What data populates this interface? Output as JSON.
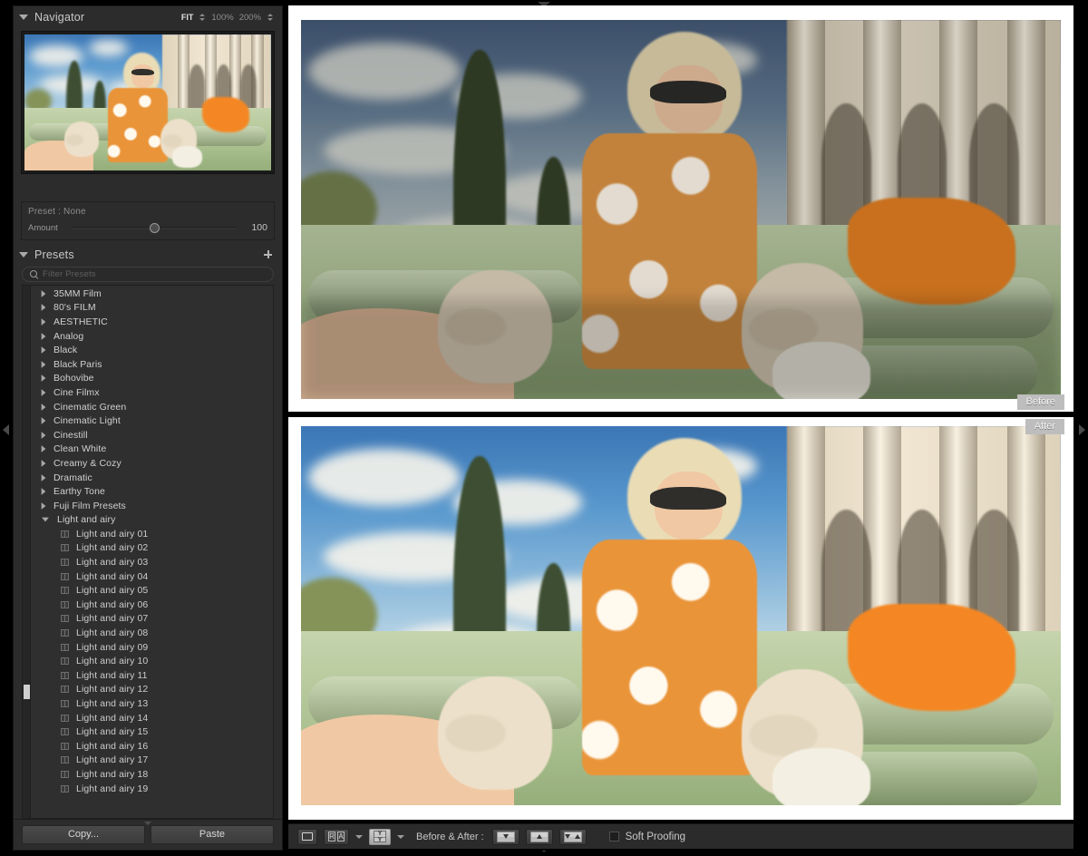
{
  "app": {
    "module": "Develop"
  },
  "navigator": {
    "title": "Navigator",
    "disclosure": "expanded",
    "zoom_levels": [
      {
        "label": "FIT",
        "active": true
      },
      {
        "label": "100%",
        "active": false
      },
      {
        "label": "200%",
        "active": false
      }
    ]
  },
  "preset_amount": {
    "preset_label": "Preset : None",
    "amount_label": "Amount",
    "amount_value": "100",
    "slider_percent": 50
  },
  "presets_panel": {
    "title": "Presets",
    "disclosure": "expanded",
    "add_button_label": "+",
    "filter": {
      "placeholder": "Filter Presets",
      "value": ""
    },
    "groups": [
      {
        "label": "35MM Film",
        "expanded": false
      },
      {
        "label": "80's FILM",
        "expanded": false
      },
      {
        "label": "AESTHETIC",
        "expanded": false
      },
      {
        "label": "Analog",
        "expanded": false
      },
      {
        "label": "Black",
        "expanded": false
      },
      {
        "label": "Black Paris",
        "expanded": false
      },
      {
        "label": "Bohovibe",
        "expanded": false
      },
      {
        "label": "Cine Filmx",
        "expanded": false
      },
      {
        "label": "Cinematic Green",
        "expanded": false
      },
      {
        "label": "Cinematic Light",
        "expanded": false
      },
      {
        "label": "Cinestill",
        "expanded": false
      },
      {
        "label": "Clean White",
        "expanded": false
      },
      {
        "label": "Creamy & Cozy",
        "expanded": false
      },
      {
        "label": "Dramatic",
        "expanded": false
      },
      {
        "label": "Earthy Tone",
        "expanded": false
      },
      {
        "label": "Fuji Film Presets",
        "expanded": false
      },
      {
        "label": "Light and airy",
        "expanded": true
      }
    ],
    "expanded_group_items": [
      "Light and airy 01",
      "Light and airy 02",
      "Light and airy 03",
      "Light and airy 04",
      "Light and airy 05",
      "Light and airy 06",
      "Light and airy 07",
      "Light and airy 08",
      "Light and airy 09",
      "Light and airy 10",
      "Light and airy 11",
      "Light and airy 12",
      "Light and airy 13",
      "Light and airy 14",
      "Light and airy 15",
      "Light and airy 16",
      "Light and airy 17",
      "Light and airy 18",
      "Light and airy 19"
    ]
  },
  "left_bottom": {
    "copy_label": "Copy...",
    "paste_label": "Paste"
  },
  "image_view": {
    "before_label": "Before",
    "after_label": "After",
    "mode": "before-after-top-bottom"
  },
  "toolbar": {
    "loupe_icon": "loupe-view-icon",
    "reference_compare_icon": "RA",
    "reference_letters": [
      "R",
      "A"
    ],
    "split_view_icon": "Y",
    "split_view_letters": [
      "Y",
      "Y"
    ],
    "before_after_label": "Before & After :",
    "copy_after_to_before_icon": "arrow-down-icon",
    "copy_before_to_after_icon": "arrow-up-icon",
    "swap_before_after_icon": "swap-arrows-icon",
    "soft_proofing_label": "Soft Proofing",
    "soft_proofing_checked": false
  },
  "colors": {
    "panel_bg": "#2c2c2c",
    "panel_text": "#cfcfcf",
    "frame": "#000000",
    "accent_active": "#cccccc",
    "badge_bg": "#bdbdbd"
  }
}
